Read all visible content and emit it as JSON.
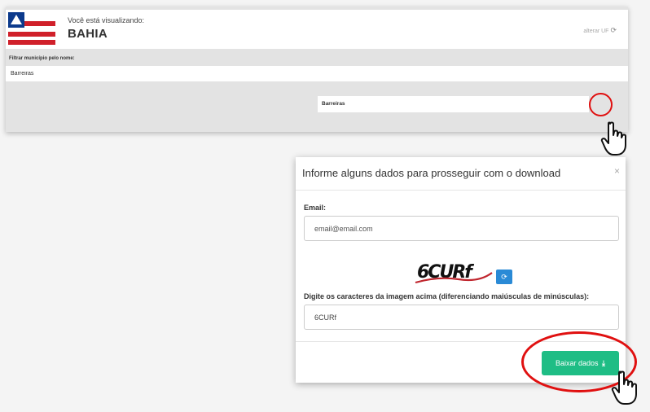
{
  "header": {
    "viewing_label": "Você está visualizando:",
    "state_name": "BAHIA",
    "change_uf_label": "alterar UF"
  },
  "filter": {
    "label": "Filtrar município pelo nome:",
    "value": "Barreiras"
  },
  "results": [
    {
      "name": "Barreiras"
    }
  ],
  "modal": {
    "title": "Informe alguns dados para prosseguir com o download",
    "close_symbol": "×",
    "email_label": "Email:",
    "email_value": "email@email.com",
    "captcha_text": "6CURf",
    "captcha_label": "Digite os caracteres da imagem acima (diferenciando maiúsculas de minúsculas):",
    "captcha_value": "6CURf",
    "download_label": "Baixar dados"
  },
  "colors": {
    "download_button": "#1fbd85",
    "highlight": "#e01010",
    "refresh_button": "#2a8ad6"
  },
  "icons": {
    "refresh": "refresh-icon",
    "globe": "globe-icon",
    "excel": "excel-icon",
    "download": "download-icon",
    "hand_cursor": "hand-pointer-icon"
  }
}
